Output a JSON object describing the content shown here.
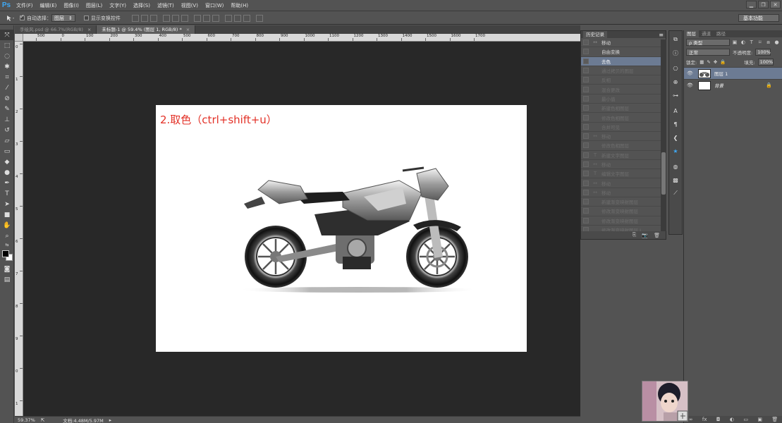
{
  "app": {
    "logo": "Ps",
    "menu": [
      "文件(F)",
      "编辑(E)",
      "图像(I)",
      "图层(L)",
      "文字(Y)",
      "选择(S)",
      "滤镜(T)",
      "视图(V)",
      "窗口(W)",
      "帮助(H)"
    ],
    "window_controls": [
      "▁",
      "❐",
      "✕"
    ],
    "workspace": "基本功能"
  },
  "options_bar": {
    "tool_icon": "move-tool-icon",
    "auto_select_label": "自动选择：",
    "auto_select_value": "图层",
    "show_transform_label": "显示变换控件"
  },
  "tabs": [
    {
      "label": "手绘风.psd @ 66.7%(RGB/8)",
      "close": "×",
      "active": false
    },
    {
      "label": "未标题-1 @ 59.4% (图层 1, RGB/8) *",
      "close": "×",
      "active": true
    }
  ],
  "ruler": {
    "h_labels": [
      "500",
      "0",
      "100",
      "200",
      "300",
      "400",
      "500",
      "600",
      "700",
      "800",
      "900",
      "1000",
      "1100",
      "1200",
      "1300",
      "1400",
      "1500",
      "1600",
      "1700"
    ],
    "v_labels": [
      "0",
      "1",
      "2",
      "3",
      "4",
      "5",
      "6",
      "7",
      "8",
      "9",
      "0",
      "1"
    ]
  },
  "document": {
    "caption": "2.取色（ctrl+shift+u）"
  },
  "status": {
    "zoom": "59.37%",
    "doc_size": "文档:4.48M/5.97M"
  },
  "history": {
    "tab_label": "历史记录",
    "menu_glyph": "≡",
    "rows": [
      {
        "icon": "↔",
        "label": "移动",
        "dim": false,
        "selected": false
      },
      {
        "icon": "",
        "label": "自由变换",
        "dim": false,
        "selected": false
      },
      {
        "icon": "",
        "label": "去色",
        "dim": false,
        "selected": true
      },
      {
        "icon": "",
        "label": "通过拷贝的图层",
        "dim": true,
        "selected": false
      },
      {
        "icon": "",
        "label": "反相",
        "dim": true,
        "selected": false
      },
      {
        "icon": "",
        "label": "混合更改",
        "dim": true,
        "selected": false
      },
      {
        "icon": "",
        "label": "最小值",
        "dim": true,
        "selected": false
      },
      {
        "icon": "",
        "label": "新建色相图层",
        "dim": true,
        "selected": false
      },
      {
        "icon": "",
        "label": "修改色相图层",
        "dim": true,
        "selected": false
      },
      {
        "icon": "",
        "label": "合并可见",
        "dim": true,
        "selected": false
      },
      {
        "icon": "↔",
        "label": "移动",
        "dim": true,
        "selected": false
      },
      {
        "icon": "",
        "label": "修改色相图层",
        "dim": true,
        "selected": false
      },
      {
        "icon": "T",
        "label": "新建文字图层",
        "dim": true,
        "selected": false
      },
      {
        "icon": "↔",
        "label": "移动",
        "dim": true,
        "selected": false
      },
      {
        "icon": "T",
        "label": "编辑文字图层",
        "dim": true,
        "selected": false
      },
      {
        "icon": "↔",
        "label": "移动",
        "dim": true,
        "selected": false
      },
      {
        "icon": "↔",
        "label": "移动",
        "dim": true,
        "selected": false
      },
      {
        "icon": "",
        "label": "新建渐变映射图层",
        "dim": true,
        "selected": false
      },
      {
        "icon": "",
        "label": "修改渐变映射图层",
        "dim": true,
        "selected": false
      },
      {
        "icon": "",
        "label": "修改渐变映射图层",
        "dim": true,
        "selected": false
      },
      {
        "icon": "",
        "label": "修改渐变映射图层 L",
        "dim": true,
        "selected": false
      }
    ],
    "footer_icons": [
      "⎘",
      "📷",
      "🗑"
    ]
  },
  "layers": {
    "tabs": [
      "图层",
      "通道",
      "路径"
    ],
    "filter_value": "ρ 类型",
    "blend_mode": "正常",
    "opacity_label": "不透明度:",
    "opacity_value": "100%",
    "lock_label": "锁定:",
    "fill_label": "填充:",
    "fill_value": "100%",
    "items": [
      {
        "name": "图层 1",
        "selected": true,
        "italic": false,
        "locked": false
      },
      {
        "name": "背景",
        "selected": false,
        "italic": true,
        "locked": true
      }
    ],
    "footer_icons": [
      "∞",
      "fx",
      "◘",
      "◐",
      "▭",
      "▣",
      "🗑"
    ]
  },
  "colors": {
    "accent_blue": "#3fa9f5",
    "selected_row": "#6c7b93",
    "caption_red": "#e33127"
  }
}
